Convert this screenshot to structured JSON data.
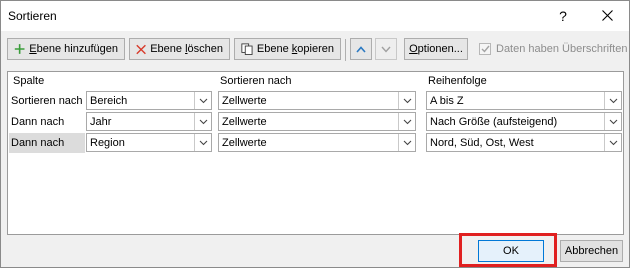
{
  "dialog": {
    "title": "Sortieren",
    "help": "?"
  },
  "toolbar": {
    "add_level_pre": "",
    "add_level_u": "E",
    "add_level_post": "bene hinzufügen",
    "delete_level_pre": "Ebene ",
    "delete_level_u": "l",
    "delete_level_post": "öschen",
    "copy_level_pre": "Ebene ",
    "copy_level_u": "k",
    "copy_level_post": "opieren",
    "options_pre": "",
    "options_u": "O",
    "options_post": "ptionen...",
    "header_checkbox_label": "Daten haben Überschriften",
    "header_checkbox_checked": true,
    "move_down_enabled": false
  },
  "grid": {
    "headers": {
      "column": "Spalte",
      "sort_on": "Sortieren nach",
      "order": "Reihenfolge"
    },
    "rows": [
      {
        "label": "Sortieren nach",
        "column": "Bereich",
        "sort_on": "Zellwerte",
        "order": "A bis Z",
        "selected": false
      },
      {
        "label": "Dann nach",
        "column": "Jahr",
        "sort_on": "Zellwerte",
        "order": "Nach Größe (aufsteigend)",
        "selected": false
      },
      {
        "label": "Dann nach",
        "column": "Region",
        "sort_on": "Zellwerte",
        "order": "Nord, Süd, Ost, West",
        "selected": true
      }
    ]
  },
  "footer": {
    "ok": "OK",
    "cancel": "Abbrechen"
  },
  "colors": {
    "add_icon": "#3a9d3a",
    "delete_icon": "#d83b2b",
    "arrow_up": "#2b79c2",
    "highlight": "#e02020",
    "selected_row": "#dcdcdc"
  }
}
